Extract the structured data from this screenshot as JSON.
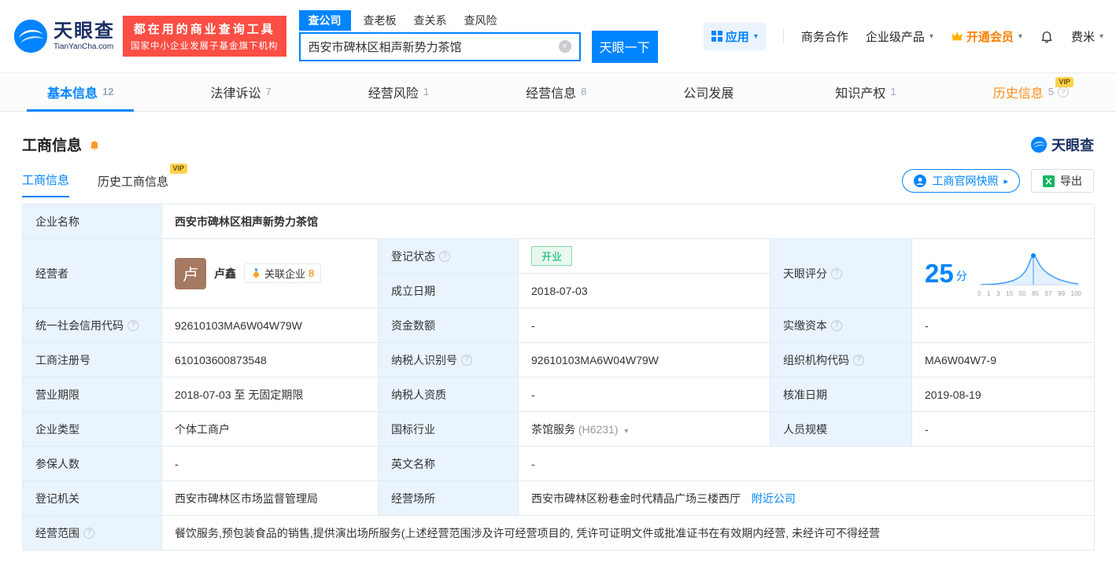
{
  "header": {
    "brand": "天眼查",
    "brand_domain": "TianYanCha.com",
    "banner_line1": "都在用的商业查询工具",
    "banner_line2": "国家中小企业发展子基金旗下机构",
    "search_tabs": [
      {
        "label": "查公司"
      },
      {
        "label": "查老板"
      },
      {
        "label": "查关系"
      },
      {
        "label": "查风险"
      }
    ],
    "search_value": "西安市碑林区相声新势力茶馆",
    "search_button": "天眼一下",
    "nav": {
      "apps": "应用",
      "cooperation": "商务合作",
      "enterprise": "企业级产品",
      "vip": "开通会员",
      "user": "费米"
    }
  },
  "tabs": [
    {
      "label": "基本信息",
      "count": "12"
    },
    {
      "label": "法律诉讼",
      "count": "7"
    },
    {
      "label": "经营风险",
      "count": "1"
    },
    {
      "label": "经营信息",
      "count": "8"
    },
    {
      "label": "公司发展",
      "count": ""
    },
    {
      "label": "知识产权",
      "count": "1"
    },
    {
      "label": "历史信息",
      "count": "5",
      "vip": "VIP"
    }
  ],
  "section": {
    "title": "工商信息",
    "brand_mark": "天眼查",
    "subtabs": [
      {
        "label": "工商信息"
      },
      {
        "label": "历史工商信息",
        "vip": "VIP"
      }
    ],
    "snapshot_button": "工商官网快照",
    "export_button": "导出"
  },
  "info": {
    "company_name_label": "企业名称",
    "company_name": "西安市碑林区相声新势力茶馆",
    "operator_label": "经营者",
    "operator_avatar": "卢",
    "operator_name": "卢鑫",
    "related_label": "关联企业",
    "related_count": "8",
    "reg_status_label": "登记状态",
    "reg_status": "开业",
    "establish_label": "成立日期",
    "establish_date": "2018-07-03",
    "score_label": "天眼评分",
    "credit_code_label": "统一社会信用代码",
    "credit_code": "92610103MA6W04W79W",
    "capital_label": "资金数额",
    "capital": "-",
    "paid_capital_label": "实缴资本",
    "paid_capital": "-",
    "reg_no_label": "工商注册号",
    "reg_no": "610103600873548",
    "taxpayer_id_label": "纳税人识别号",
    "taxpayer_id": "92610103MA6W04W79W",
    "org_code_label": "组织机构代码",
    "org_code": "MA6W04W7-9",
    "term_label": "营业期限",
    "term": "2018-07-03 至 无固定期限",
    "taxpayer_quality_label": "纳税人资质",
    "taxpayer_quality": "-",
    "approval_label": "核准日期",
    "approval_date": "2019-08-19",
    "type_label": "企业类型",
    "type": "个体工商户",
    "industry_label": "国标行业",
    "industry": "茶馆服务",
    "industry_code": "(H6231)",
    "staff_label": "人员规模",
    "staff": "-",
    "insured_label": "参保人数",
    "insured": "-",
    "english_label": "英文名称",
    "english_name": "-",
    "authority_label": "登记机关",
    "authority": "西安市碑林区市场监督管理局",
    "premises_label": "经营场所",
    "premises": "西安市碑林区粉巷金时代精品广场三楼西厅",
    "nearby_link": "附近公司",
    "scope_label": "经营范围",
    "scope": "餐饮服务,预包装食品的销售,提供演出场所服务(上述经营范围涉及许可经营项目的, 凭许可证明文件或批准证书在有效期内经营, 未经许可不得经营"
  },
  "score_chart": {
    "score": "25",
    "unit": "分",
    "ticks": [
      "0",
      "1",
      "3",
      "15",
      "50",
      "85",
      "97",
      "99",
      "100"
    ]
  },
  "colors": {
    "accent": "#0084ff",
    "vip_orange": "#ff8000",
    "status_green": "#00b365",
    "banner_red": "#fb4e44",
    "label_cell_bg": "#e9f4fe"
  }
}
